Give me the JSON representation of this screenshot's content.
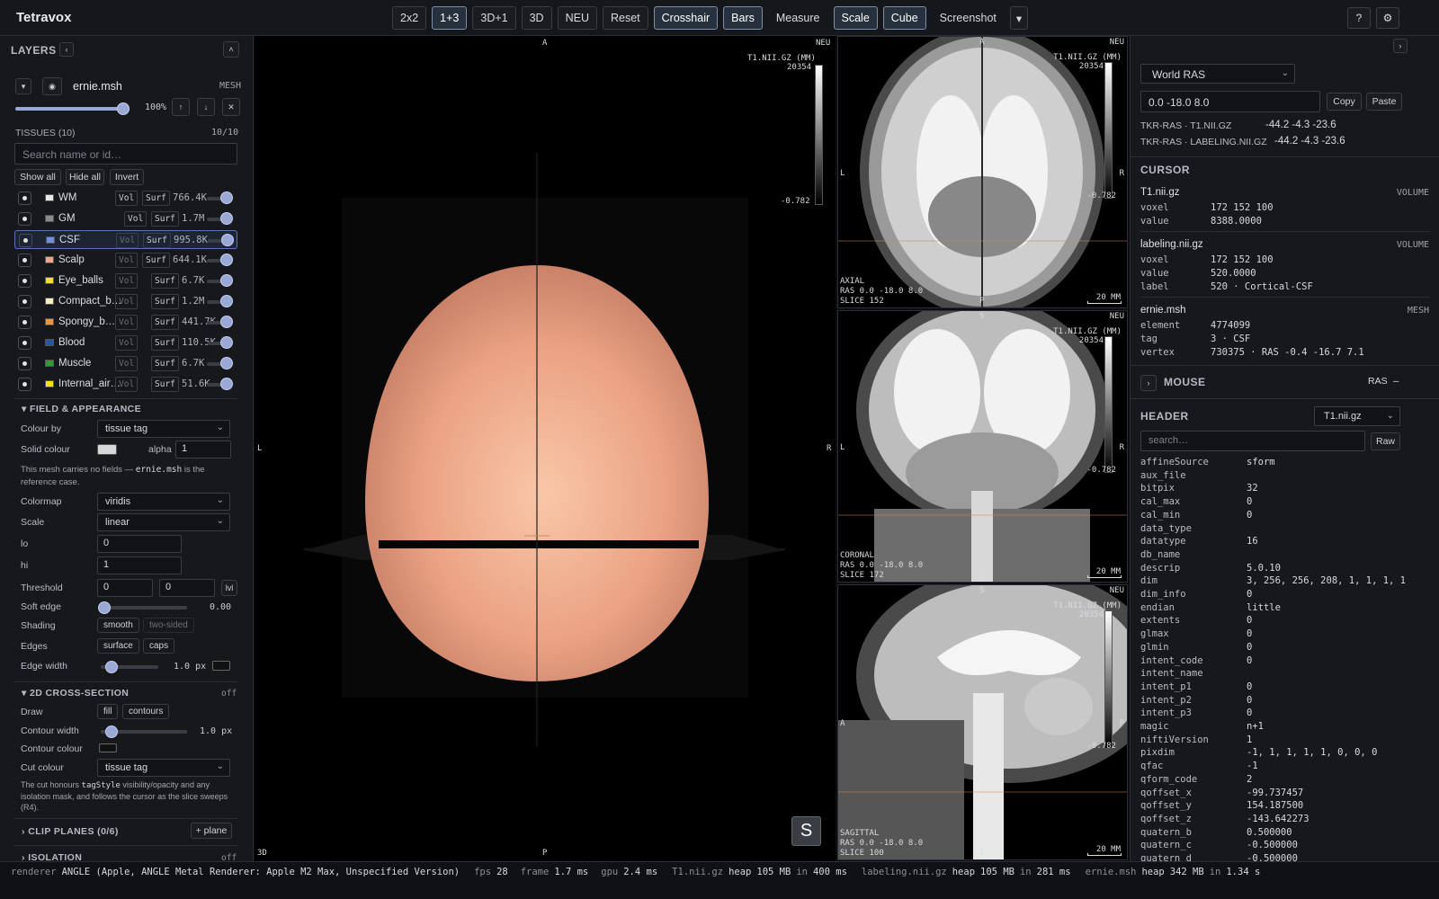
{
  "app": {
    "title": "Tetravox"
  },
  "toolbar": {
    "buttons": [
      "2x2",
      "1+3",
      "3D+1",
      "3D",
      "NEU",
      "Reset",
      "Crosshair",
      "Bars",
      "Measure",
      "Scale",
      "Cube",
      "Screenshot"
    ],
    "active": [
      "1+3",
      "Crosshair",
      "Bars",
      "Scale",
      "Cube"
    ],
    "help": "?",
    "settings": "⚙"
  },
  "layers": {
    "title": "LAYERS",
    "mesh": {
      "name": "ernie.msh",
      "type": "MESH",
      "opacity": "100%",
      "opacity_fraction": 1.0
    },
    "tissues_label": "TISSUES (10)",
    "tissues_count": "10/10",
    "search_placeholder": "Search name or id…",
    "show_all": "Show all",
    "hide_all": "Hide all",
    "invert": "Invert",
    "vol": "Vol",
    "surf": "Surf",
    "tissues": [
      {
        "name": "WM",
        "color": "#e8e8e8",
        "size": "766.4K",
        "vol_dim": false
      },
      {
        "name": "GM",
        "color": "#8a8a8a",
        "size": "1.7M",
        "vol_dim": false
      },
      {
        "name": "CSF",
        "color": "#6f8fd9",
        "size": "995.8K",
        "vol_dim": true,
        "selected": true
      },
      {
        "name": "Scalp",
        "color": "#f1a48c",
        "size": "644.1K",
        "vol_dim": true
      },
      {
        "name": "Eye_balls",
        "color": "#f1e02a",
        "size": "6.7K",
        "vol_dim": true
      },
      {
        "name": "Compact_b…",
        "color": "#f3efc7",
        "size": "1.2M",
        "vol_dim": true
      },
      {
        "name": "Spongy_b…",
        "color": "#f0963a",
        "size": "441.7K",
        "vol_dim": true
      },
      {
        "name": "Blood",
        "color": "#2356a8",
        "size": "110.5K",
        "vol_dim": true
      },
      {
        "name": "Muscle",
        "color": "#2f9a3a",
        "size": "6.7K",
        "vol_dim": true
      },
      {
        "name": "Internal_air…",
        "color": "#f3e21a",
        "size": "51.6K",
        "vol_dim": true
      }
    ]
  },
  "field": {
    "title": "FIELD & APPEARANCE",
    "colour_by_label": "Colour by",
    "colour_by": "tissue tag",
    "solid_colour_label": "Solid colour",
    "alpha_label": "alpha",
    "alpha": "1",
    "note_a": "This mesh carries no fields — ",
    "note_code": "ernie.msh",
    "note_b": " is the reference case.",
    "colormap_label": "Colormap",
    "colormap": "viridis",
    "scale_label": "Scale",
    "scale": "linear",
    "lo_label": "lo",
    "lo": "0",
    "hi_label": "hi",
    "hi": "1",
    "threshold_label": "Threshold",
    "threshold_a": "0",
    "threshold_b": "0",
    "lvl": "lvl",
    "soft_edge_label": "Soft edge",
    "soft_edge": "0.00",
    "shading_label": "Shading",
    "smooth": "smooth",
    "two_sided": "two-sided",
    "edges_label": "Edges",
    "surface": "surface",
    "caps": "caps",
    "edge_width_label": "Edge width",
    "edge_width": "1.0 px"
  },
  "cross": {
    "title": "2D CROSS-SECTION",
    "state": "off",
    "draw_label": "Draw",
    "fill": "fill",
    "contours": "contours",
    "contour_width_label": "Contour width",
    "contour_width": "1.0 px",
    "contour_colour_label": "Contour colour",
    "cut_colour_label": "Cut colour",
    "cut_colour": "tissue tag",
    "note_a": "The cut honours ",
    "note_code": "tagStyle",
    "note_b": " visibility/opacity and any isolation mask, and follows the cursor as the slice sweeps (R4)."
  },
  "clip": {
    "title": "CLIP PLANES (0/6)",
    "add": "+ plane"
  },
  "isolation": {
    "title": "ISOLATION",
    "state": "off"
  },
  "view3d": {
    "top": "A",
    "bottom": "P",
    "left": "L",
    "right": "R",
    "corner": "3D",
    "neu": "NEU",
    "cbar_title": "T1.NII.GZ (MM)",
    "cbar_max": "20354",
    "cbar_min": "-0.782",
    "s_button": "S"
  },
  "slices": [
    {
      "name": "AXIAL",
      "coords": "RAS 0.0 -18.0 8.0",
      "slice": "SLICE 152",
      "top": "A",
      "bottom": "P",
      "left": "L",
      "right": "R",
      "scale": "20 MM",
      "neu": "NEU",
      "cbar_title": "T1.NII.GZ (MM)",
      "cbar_max": "20354",
      "cbar_min": "-0.782"
    },
    {
      "name": "CORONAL",
      "coords": "RAS 0.0 -18.0 8.0",
      "slice": "SLICE 172",
      "top": "S",
      "bottom": "I",
      "left": "L",
      "right": "R",
      "scale": "20 MM",
      "neu": "NEU",
      "cbar_title": "T1.NII.GZ (MM)",
      "cbar_max": "20354",
      "cbar_min": "-0.782"
    },
    {
      "name": "SAGITTAL",
      "coords": "RAS 0.0 -18.0 8.0",
      "slice": "SLICE 100",
      "top": "S",
      "bottom": "I",
      "left": "A",
      "right": "P",
      "scale": "20 MM",
      "neu": "NEU",
      "cbar_title": "T1.NII.GZ (MM)",
      "cbar_max": "20354",
      "cbar_min": "-0.782"
    }
  ],
  "coords": {
    "space": "World RAS",
    "value": "0.0 -18.0 8.0",
    "copy": "Copy",
    "paste": "Paste",
    "rows": [
      {
        "label": "TKR-RAS · T1.NII.GZ",
        "value": "-44.2 -4.3 -23.6"
      },
      {
        "label": "TKR-RAS · LABELING.NII.GZ",
        "value": "-44.2 -4.3 -23.6"
      }
    ]
  },
  "cursor": {
    "title": "CURSOR",
    "items": [
      {
        "name": "T1.nii.gz",
        "kind": "VOLUME",
        "fields": [
          [
            "voxel",
            "172 152 100"
          ],
          [
            "value",
            "8388.0000"
          ]
        ]
      },
      {
        "name": "labeling.nii.gz",
        "kind": "VOLUME",
        "fields": [
          [
            "voxel",
            "172 152 100"
          ],
          [
            "value",
            "520.0000"
          ],
          [
            "label",
            "520 · Cortical-CSF"
          ]
        ]
      },
      {
        "name": "ernie.msh",
        "kind": "MESH",
        "fields": [
          [
            "element",
            "4774099"
          ],
          [
            "tag",
            "3 · CSF"
          ],
          [
            "vertex",
            "730375 · RAS -0.4 -16.7 7.1"
          ]
        ]
      }
    ]
  },
  "mouse": {
    "title": "MOUSE",
    "right": "RAS",
    "value": "—"
  },
  "header": {
    "title": "HEADER",
    "file": "T1.nii.gz",
    "search_placeholder": "search…",
    "raw": "Raw",
    "rows": [
      [
        "affineSource",
        "sform"
      ],
      [
        "aux_file",
        ""
      ],
      [
        "bitpix",
        "32"
      ],
      [
        "cal_max",
        "0"
      ],
      [
        "cal_min",
        "0"
      ],
      [
        "data_type",
        ""
      ],
      [
        "datatype",
        "16"
      ],
      [
        "db_name",
        ""
      ],
      [
        "descrip",
        "5.0.10"
      ],
      [
        "dim",
        "3, 256, 256, 208, 1, 1, 1, 1"
      ],
      [
        "dim_info",
        "0"
      ],
      [
        "endian",
        "little"
      ],
      [
        "extents",
        "0"
      ],
      [
        "glmax",
        "0"
      ],
      [
        "glmin",
        "0"
      ],
      [
        "intent_code",
        "0"
      ],
      [
        "intent_name",
        ""
      ],
      [
        "intent_p1",
        "0"
      ],
      [
        "intent_p2",
        "0"
      ],
      [
        "intent_p3",
        "0"
      ],
      [
        "magic",
        "n+1"
      ],
      [
        "niftiVersion",
        "1"
      ],
      [
        "pixdim",
        "-1, 1, 1, 1, 1, 0, 0, 0"
      ],
      [
        "qfac",
        "-1"
      ],
      [
        "qform_code",
        "2"
      ],
      [
        "qoffset_x",
        "-99.737457"
      ],
      [
        "qoffset_y",
        "154.187500"
      ],
      [
        "qoffset_z",
        "-143.642273"
      ],
      [
        "quatern_b",
        "0.500000"
      ],
      [
        "quatern_c",
        "-0.500000"
      ],
      [
        "quatern_d",
        "-0.500000"
      ]
    ]
  },
  "status": {
    "renderer_label": "renderer",
    "renderer": "ANGLE (Apple, ANGLE Metal Renderer: Apple M2 Max, Unspecified Version)",
    "fps_label": "fps",
    "fps": "28",
    "frame_label": "frame",
    "frame": "1.7 ms",
    "gpu_label": "gpu",
    "gpu": "2.4 ms",
    "files": [
      {
        "name": "T1.nii.gz",
        "heap": "105 MB",
        "time": "400 ms"
      },
      {
        "name": "labeling.nii.gz",
        "heap": "105 MB",
        "time": "281 ms"
      },
      {
        "name": "ernie.msh",
        "heap": "342 MB",
        "time": "1.34 s"
      }
    ],
    "heap_label": "heap",
    "in_label": "in"
  }
}
